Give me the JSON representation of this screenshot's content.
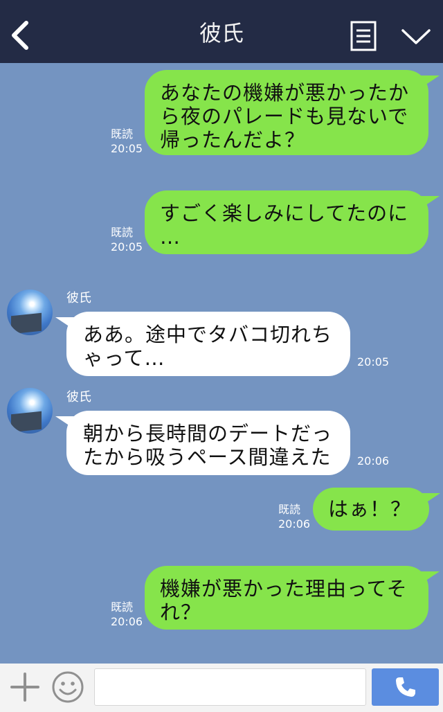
{
  "header": {
    "title": "彼氏",
    "back_icon": "chevron-left-icon",
    "menu_icon": "note-icon",
    "collapse_icon": "chevron-down-icon"
  },
  "messages": [
    {
      "from": "me",
      "lines": [
        "あなたの機嫌が悪かったか",
        "ら夜のパレードも見ないで",
        "帰ったんだよ？"
      ],
      "status": "既読",
      "time": "20:05"
    },
    {
      "from": "me",
      "lines": [
        "すごく楽しみにしてたのに",
        "…"
      ],
      "status": "既読",
      "time": "20:05"
    },
    {
      "from": "friend",
      "sender": "彼氏",
      "lines": [
        "ああ。途中でタバコ切れち",
        "ゃって…"
      ],
      "time": "20:05"
    },
    {
      "from": "friend",
      "sender": "彼氏",
      "lines": [
        "朝から長時間のデートだっ",
        "たから吸うペース間違えた"
      ],
      "time": "20:06"
    },
    {
      "from": "me",
      "lines": [
        "はぁ！？"
      ],
      "status": "既読",
      "time": "20:06"
    },
    {
      "from": "me",
      "lines": [
        "機嫌が悪かった理由ってそ",
        "れ？"
      ],
      "status": "既読",
      "time": "20:06"
    }
  ],
  "input": {
    "placeholder": ""
  },
  "colors": {
    "background": "#7494c1",
    "header": "#232b45",
    "my_bubble": "#86e44b",
    "friend_bubble": "#ffffff",
    "call_button": "#5b8de0"
  },
  "bottom_icons": [
    "plus-icon",
    "emoji-icon",
    "phone-icon"
  ]
}
